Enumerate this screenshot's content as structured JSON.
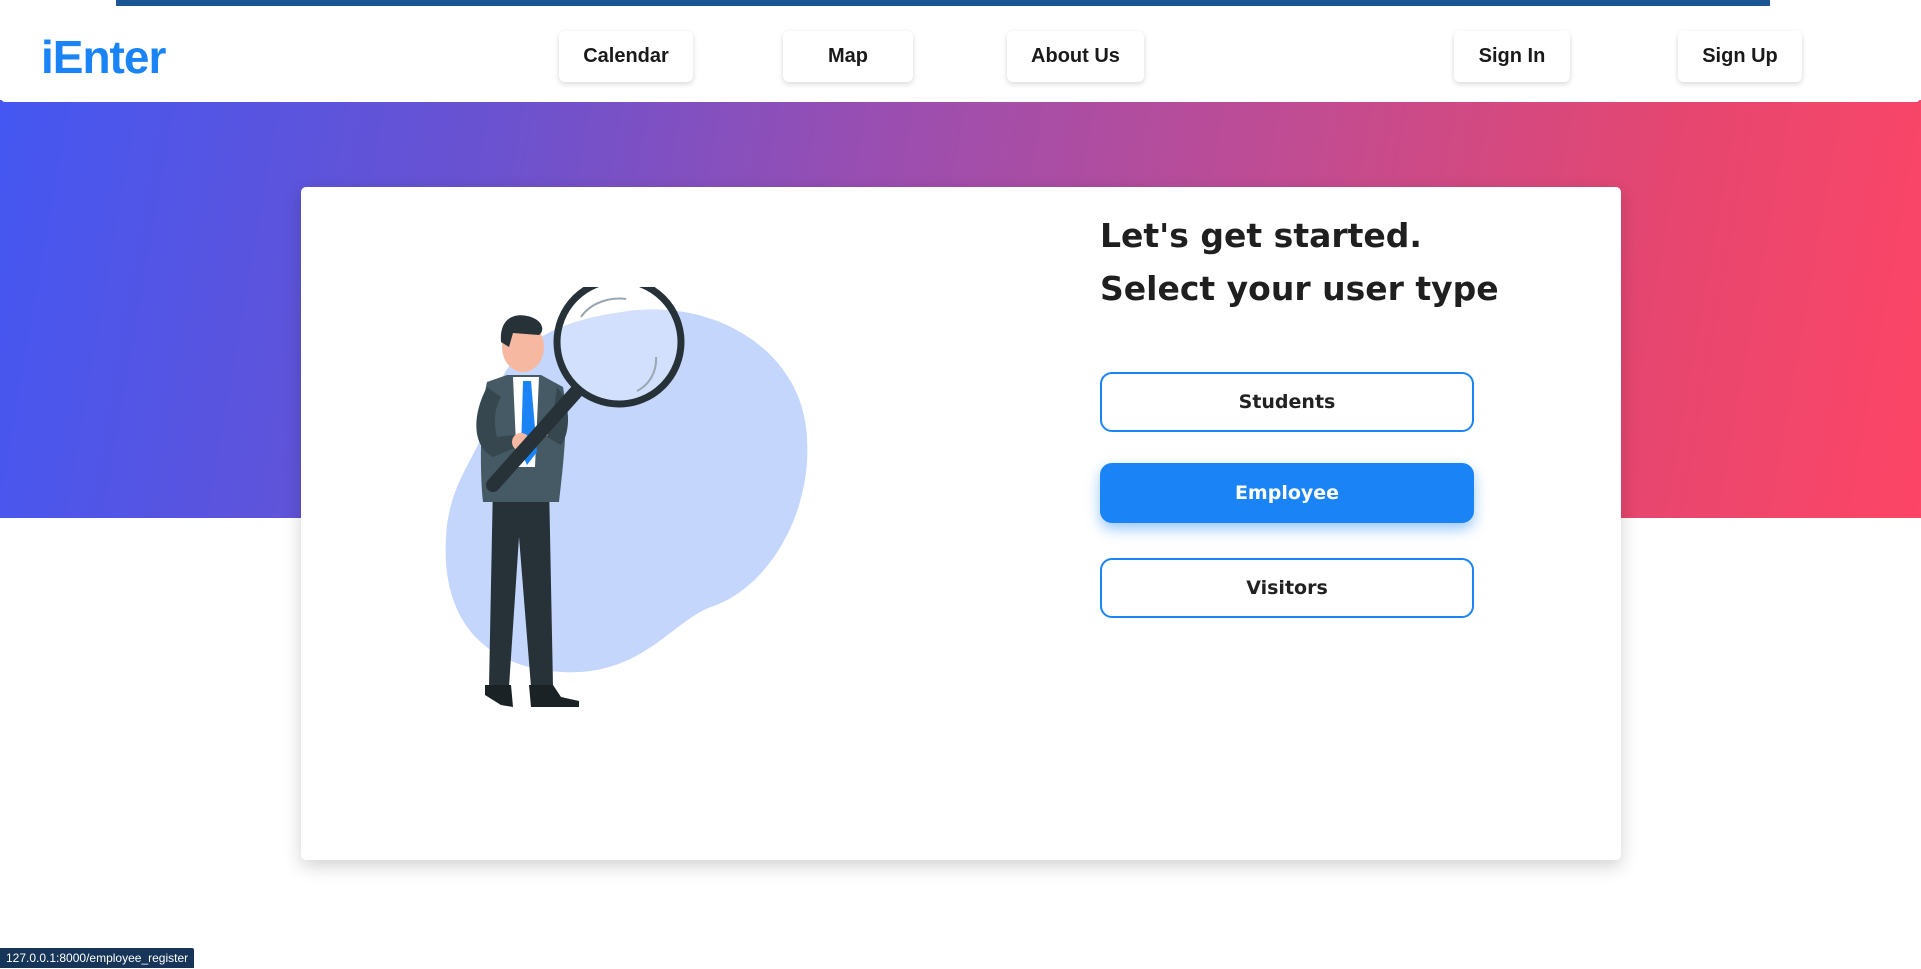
{
  "brand": {
    "name": "iEnter",
    "color": "#1a84f6"
  },
  "nav": {
    "calendar": "Calendar",
    "map": "Map",
    "about": "About Us",
    "sign_in": "Sign In",
    "sign_up": "Sign Up"
  },
  "main": {
    "heading_line1": "Let's get started.",
    "heading_line2": "Select your user type",
    "options": {
      "students": "Students",
      "employee": "Employee",
      "visitors": "Visitors"
    },
    "selected": "Employee",
    "illustration": "businessman-with-magnifier-icon"
  },
  "status_bar": {
    "url": "127.0.0.1:8000/employee_register"
  },
  "colors": {
    "accent": "#1a84f6",
    "gradient_start": "#4457f2",
    "gradient_end": "#fd4566",
    "blob": "#c5d6fd"
  }
}
